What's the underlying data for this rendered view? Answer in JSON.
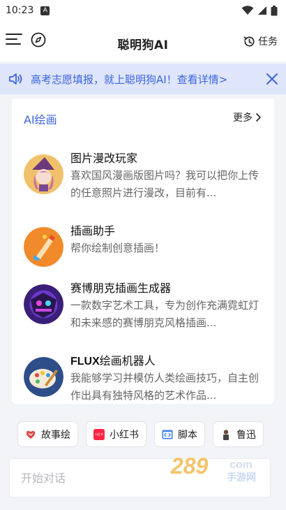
{
  "status_bar": {
    "time": "10:23",
    "app_letter": "A"
  },
  "header": {
    "title": "聪明狗AI",
    "task_label": "任务"
  },
  "banner": {
    "text": "高考志愿填报，就上聪明狗AI！查看详情>"
  },
  "section": {
    "title": "AI绘画",
    "more_label": "更多",
    "bots": [
      {
        "name": "图片漫改玩家",
        "desc": "喜欢国风漫画版图片吗？我可以把你上传的任意照片进行漫改，目前有..."
      },
      {
        "name": "插画助手",
        "desc": "帮你绘制创意插画！"
      },
      {
        "name": "赛博朋克插画生成器",
        "desc": "一款数字艺术工具，专为创作充满霓虹灯和未来感的赛博朋克风格插画..."
      },
      {
        "name_bold": "FLUX",
        "name_rest": "绘画机器人",
        "desc": "我能够学习并模仿人类绘画技巧，自主创作出具有独特风格的艺术作品..."
      }
    ]
  },
  "chips": [
    {
      "label": "故事绘",
      "icon": "story-icon",
      "color": "#d94848"
    },
    {
      "label": "小红书",
      "icon": "xiaohongshu-icon",
      "color": "#ff2442",
      "icon_text": "小红书"
    },
    {
      "label": "脚本",
      "icon": "script-icon",
      "color": "#3d7ff0"
    },
    {
      "label": "鲁迅",
      "icon": "luxun-icon",
      "color": "#444444"
    }
  ],
  "input": {
    "placeholder": "开始对话"
  },
  "watermark": {
    "text": "289",
    "subtext": "手游网",
    "suffix": "com"
  },
  "colors": {
    "accent": "#3b64e0",
    "banner_bg": "#dfe6fb",
    "page_bg": "#f3f4f7"
  }
}
